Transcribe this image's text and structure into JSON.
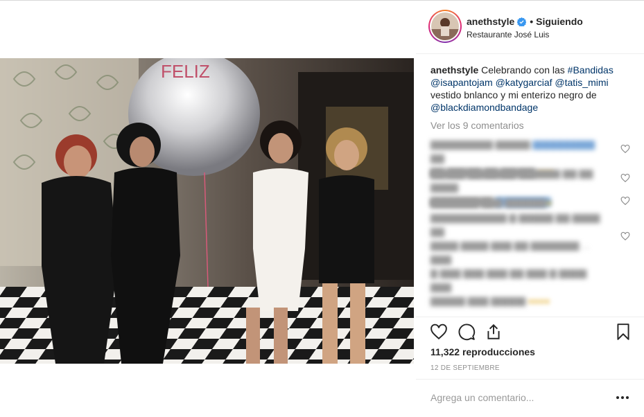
{
  "post": {
    "username": "anethstyle",
    "follow_separator": "•",
    "follow_status": "Siguiendo",
    "location": "Restaurante José Luis",
    "photo_sign_text": "FELIZ"
  },
  "caption": {
    "username": "anethstyle",
    "text_1": "Celebrando con las",
    "hashtag": "#Bandidas",
    "mention_1": "@isapantojam",
    "mention_2": "@katygarciaf",
    "mention_3": "@tatis_mimi",
    "text_2": "vestido bnlanco y mi enterizo negro de",
    "mention_4": "@blackdiamondbandage"
  },
  "view_comments": "Ver los 9 comentarios",
  "engagement": {
    "views": "11,322 reproducciones",
    "date": "12 DE SEPTIEMBRE"
  },
  "add_comment": {
    "placeholder": "Agrega un comentario..."
  },
  "icons": {
    "verified": "verified-badge-icon",
    "like": "heart-icon",
    "comment": "comment-bubble-icon",
    "share": "share-icon",
    "save": "bookmark-icon",
    "more": "more-options-icon"
  },
  "colors": {
    "link": "#003569",
    "verified": "#3897f0",
    "muted": "#8e8e8e"
  }
}
